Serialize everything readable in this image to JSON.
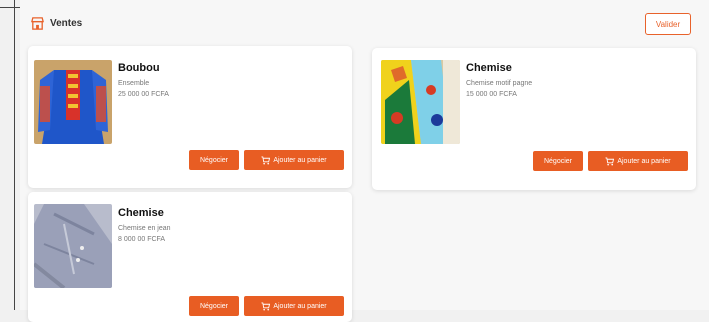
{
  "header": {
    "brand_label": "Ventes",
    "top_button_label": "Valider"
  },
  "products": [
    {
      "title": "Boubou",
      "line1": "Ensemble",
      "line2": "25 000 00 FCFA",
      "image": "boubou-photo",
      "btn_secondary": "Négocier",
      "btn_primary": "Ajouter au panier"
    },
    {
      "title": "Chemise",
      "line1": "Chemise motif pagne",
      "line2": "15 000 00 FCFA",
      "image": "chemise-photo",
      "btn_secondary": "Négocier",
      "btn_primary": "Ajouter au panier"
    },
    {
      "title": "Chemise",
      "line1": "Chemise en jean",
      "line2": "8 000 00 FCFA",
      "image": "chemise-jean-photo",
      "btn_secondary": "Négocier",
      "btn_primary": "Ajouter au panier"
    }
  ],
  "colors": {
    "accent": "#e85d23",
    "card_bg": "#ffffff"
  }
}
